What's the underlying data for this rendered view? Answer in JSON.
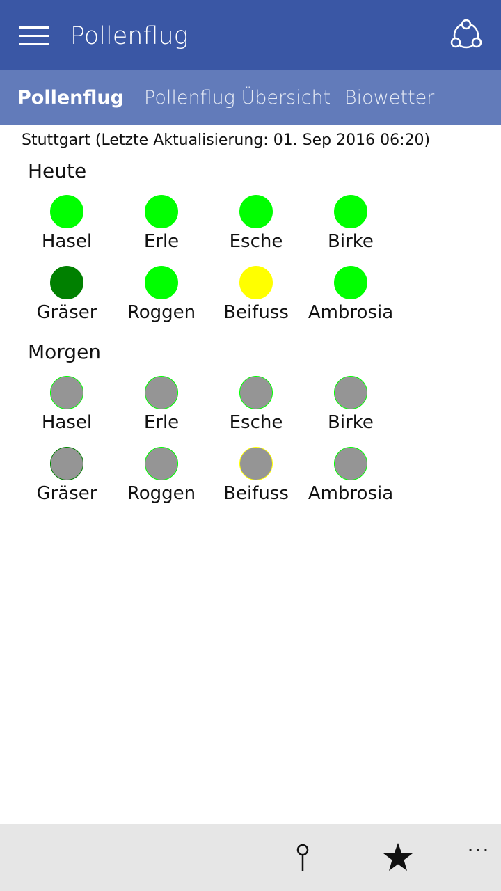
{
  "header": {
    "title": "Pollenflug",
    "menu_icon": "hamburger-menu-icon",
    "share_icon": "share-icon",
    "accent_color": "#3a57a5"
  },
  "tabs": [
    {
      "label": "Pollenflug",
      "active": true
    },
    {
      "label": "Pollenflug Übersicht",
      "active": false
    },
    {
      "label": "Biowetter",
      "active": false
    }
  ],
  "status": {
    "update_text": "Stuttgart (Letzte Aktualisierung: 01. Sep 2016 06:20)"
  },
  "days": [
    {
      "label": "Heute",
      "items": [
        {
          "name": "Hasel",
          "color": "#00ff00",
          "border": "#00ff00"
        },
        {
          "name": "Erle",
          "color": "#00ff00",
          "border": "#00ff00"
        },
        {
          "name": "Esche",
          "color": "#00ff00",
          "border": "#00ff00"
        },
        {
          "name": "Birke",
          "color": "#00ff00",
          "border": "#00ff00"
        },
        {
          "name": "Gräser",
          "color": "#008000",
          "border": "#008000"
        },
        {
          "name": "Roggen",
          "color": "#00ff00",
          "border": "#00ff00"
        },
        {
          "name": "Beifuss",
          "color": "#ffff00",
          "border": "#ffff00"
        },
        {
          "name": "Ambrosia",
          "color": "#00ff00",
          "border": "#00ff00"
        }
      ]
    },
    {
      "label": "Morgen",
      "items": [
        {
          "name": "Hasel",
          "color": "#959595",
          "border": "#00ff00"
        },
        {
          "name": "Erle",
          "color": "#959595",
          "border": "#00ff00"
        },
        {
          "name": "Esche",
          "color": "#959595",
          "border": "#00ff00"
        },
        {
          "name": "Birke",
          "color": "#959595",
          "border": "#00ff00"
        },
        {
          "name": "Gräser",
          "color": "#959595",
          "border": "#008000"
        },
        {
          "name": "Roggen",
          "color": "#959595",
          "border": "#00ff00"
        },
        {
          "name": "Beifuss",
          "color": "#959595",
          "border": "#ffff00"
        },
        {
          "name": "Ambrosia",
          "color": "#959595",
          "border": "#00ff00"
        }
      ]
    }
  ],
  "appbar": {
    "location_icon": "location-pin-icon",
    "favorite_icon": "star-icon",
    "more_label": "···"
  }
}
